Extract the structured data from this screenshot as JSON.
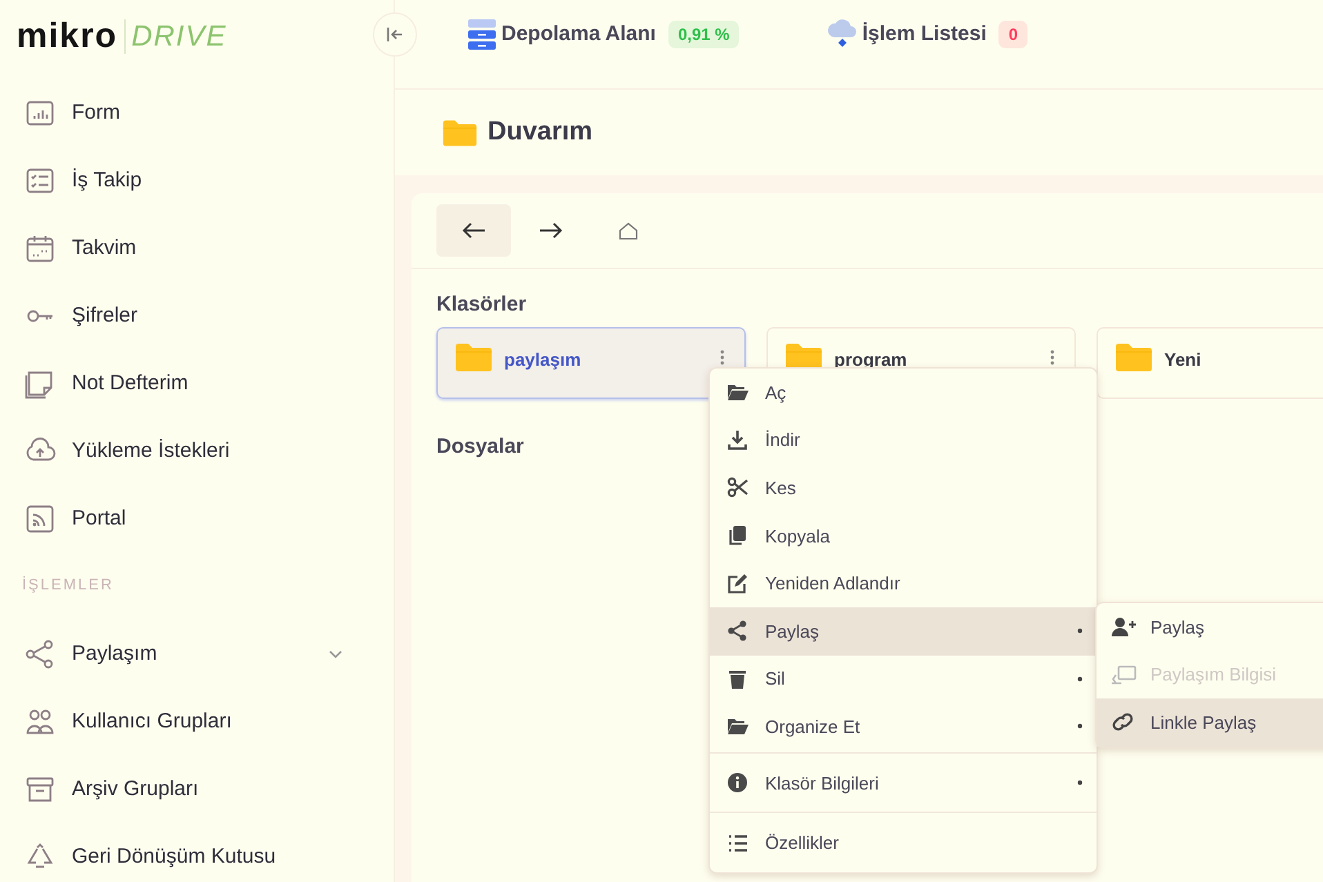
{
  "logo": {
    "brand": "mikro",
    "product": "DRIVE"
  },
  "header_items": [
    {
      "label": "Depolama Alanı",
      "badge": "0,91 %",
      "color": "#2fbf4a"
    },
    {
      "label": "İşlem Listesi",
      "badge": "0",
      "color": "#ff3b5c"
    }
  ],
  "sidebar": {
    "items": [
      {
        "label": "Form",
        "selected": false
      },
      {
        "label": "İş Takip",
        "selected": false
      },
      {
        "label": "Takvim",
        "selected": false
      },
      {
        "label": "Şifreler",
        "selected": false
      },
      {
        "label": "Not Defterim",
        "selected": false
      },
      {
        "label": "Yükleme İstekleri",
        "selected": false
      },
      {
        "label": "Portal",
        "selected": false
      },
      {
        "kind": "heading",
        "label": "İŞLEMLER"
      },
      {
        "label": "Paylaşım",
        "selected": false,
        "expanded": false
      },
      {
        "label": "Kullanıcı Grupları",
        "selected": false
      },
      {
        "label": "Arşiv Grupları",
        "selected": false
      },
      {
        "label": "Geri Dönüşüm Kutusu",
        "selected": false
      }
    ]
  },
  "page_title": "Duvarım",
  "nav_buttons": [
    {
      "kind": "back",
      "highlighted": true
    },
    {
      "kind": "forward",
      "highlighted": false
    },
    {
      "kind": "home",
      "highlighted": false
    }
  ],
  "folders_heading": "Klasörler",
  "folders": [
    {
      "name": "paylaşım",
      "selected": true
    },
    {
      "name": "program",
      "selected": false
    },
    {
      "name": "Yeni",
      "selected": false
    }
  ],
  "files_heading": "Dosyalar",
  "context_menu": {
    "groups": [
      [
        {
          "label": "Aç",
          "selected": false,
          "submenu": false
        },
        {
          "label": "İndir",
          "selected": false,
          "submenu": false
        },
        {
          "label": "Kes",
          "selected": false,
          "submenu": false
        },
        {
          "label": "Kopyala",
          "selected": false,
          "submenu": false
        },
        {
          "label": "Yeniden Adlandır",
          "selected": false,
          "submenu": false
        },
        {
          "label": "Paylaş",
          "selected": true,
          "submenu": true
        },
        {
          "label": "Sil",
          "selected": false,
          "submenu": true
        },
        {
          "label": "Organize Et",
          "selected": false,
          "submenu": true
        }
      ],
      [
        {
          "label": "Klasör Bilgileri",
          "selected": false,
          "submenu": true
        }
      ],
      [
        {
          "label": "Özellikler",
          "selected": false,
          "submenu": false
        }
      ]
    ]
  },
  "submenu": [
    {
      "label": "Paylaş",
      "selected": false,
      "disabled": false
    },
    {
      "label": "Paylaşım Bilgisi",
      "selected": false,
      "disabled": true
    },
    {
      "label": "Linkle Paylaş",
      "selected": true,
      "disabled": false
    }
  ]
}
